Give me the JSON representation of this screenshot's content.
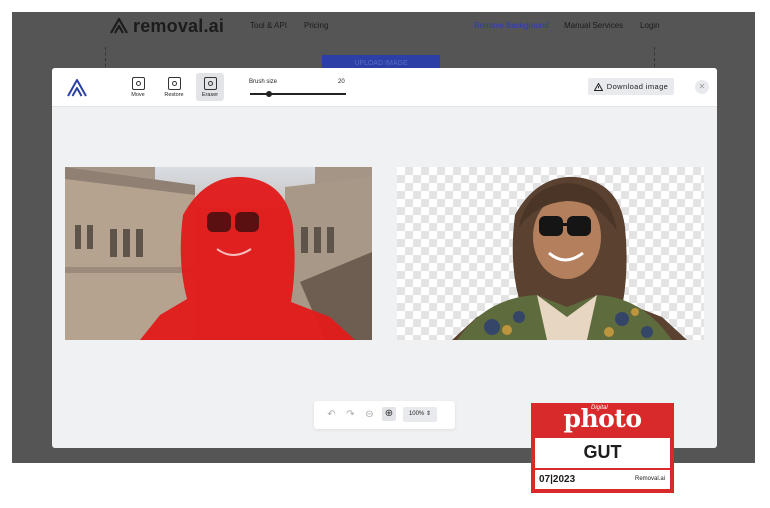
{
  "site": {
    "logo_text": "removal.ai",
    "nav": [
      "Tool & API",
      "Pricing",
      "Remove Background",
      "Manual Services",
      "Login"
    ],
    "upload_label": "UPLOAD IMAGE"
  },
  "editor": {
    "tools": [
      {
        "label": "Move",
        "icon": "move-icon"
      },
      {
        "label": "Restore",
        "icon": "restore-icon"
      },
      {
        "label": "Eraser",
        "icon": "eraser-icon"
      }
    ],
    "active_tool": "Eraser",
    "brush": {
      "label": "Brush size",
      "value": "20",
      "slider_level": 0.2
    },
    "download_label": "Download image",
    "close_icon": "close-icon"
  },
  "zoombar": {
    "icons": [
      "undo-icon",
      "redo-icon",
      "zoom-out-icon",
      "zoom-in-icon"
    ],
    "zoom_value": "100%"
  },
  "badge": {
    "digital": "Digital",
    "photo": "photo",
    "rating": "GUT",
    "date": "07|2023",
    "brand": "Removal.ai"
  },
  "colors": {
    "accent": "#2b3fa6",
    "mask": "#e11b1b",
    "badge": "#d82a2a"
  }
}
